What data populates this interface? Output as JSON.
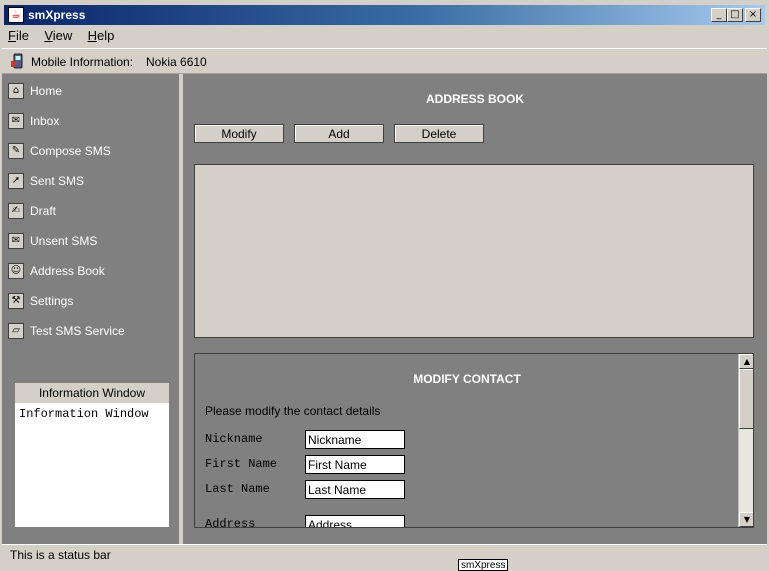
{
  "window": {
    "title": "smXpress",
    "app_icon": "java-cup-icon",
    "controls": [
      "minimize-icon",
      "maximize-icon",
      "close-icon"
    ]
  },
  "menu": {
    "items": [
      {
        "label_first": "F",
        "label_rest": "ile"
      },
      {
        "label_first": "V",
        "label_rest": "iew"
      },
      {
        "label_first": "H",
        "label_rest": "elp"
      }
    ]
  },
  "info_bar": {
    "label": "Mobile Information:",
    "value": "Nokia 6610",
    "icon": "phone-icon"
  },
  "sidebar": {
    "items": [
      {
        "label": "Home",
        "icon": "home-icon",
        "glyph": "⌂"
      },
      {
        "label": "Inbox",
        "icon": "inbox-icon",
        "glyph": "✉"
      },
      {
        "label": "Compose SMS",
        "icon": "compose-icon",
        "glyph": "✎"
      },
      {
        "label": "Sent SMS",
        "icon": "sent-icon",
        "glyph": "➚"
      },
      {
        "label": "Draft",
        "icon": "draft-icon",
        "glyph": "✍"
      },
      {
        "label": "Unsent SMS",
        "icon": "unsent-icon",
        "glyph": "✉"
      },
      {
        "label": "Address Book",
        "icon": "address-book-icon",
        "glyph": "☺"
      },
      {
        "label": "Settings",
        "icon": "settings-icon",
        "glyph": "⚒"
      },
      {
        "label": "Test SMS Service",
        "icon": "folder-icon",
        "glyph": "▱"
      }
    ]
  },
  "info_window": {
    "header": "Information Window",
    "body": "Information Window"
  },
  "address_book": {
    "title": "ADDRESS BOOK",
    "buttons": {
      "modify": "Modify",
      "add": "Add",
      "delete": "Delete"
    }
  },
  "modify_contact": {
    "title": "MODIFY CONTACT",
    "instructions": "Please modify the contact details",
    "fields": {
      "nickname": {
        "label": "Nickname",
        "value": "Nickname"
      },
      "first_name": {
        "label": "First Name",
        "value": "First Name"
      },
      "last_name": {
        "label": "Last Name",
        "value": "Last Name"
      },
      "address": {
        "label": "Address",
        "value": "Address"
      }
    }
  },
  "status_bar": {
    "text": "This is a status bar"
  },
  "tooltip": {
    "text": "smXpress"
  },
  "colors": {
    "title_gradient_start": "#0a246a",
    "title_gradient_end": "#a6caf0",
    "panel_gray": "#808080",
    "face_gray": "#d4d0c8"
  }
}
